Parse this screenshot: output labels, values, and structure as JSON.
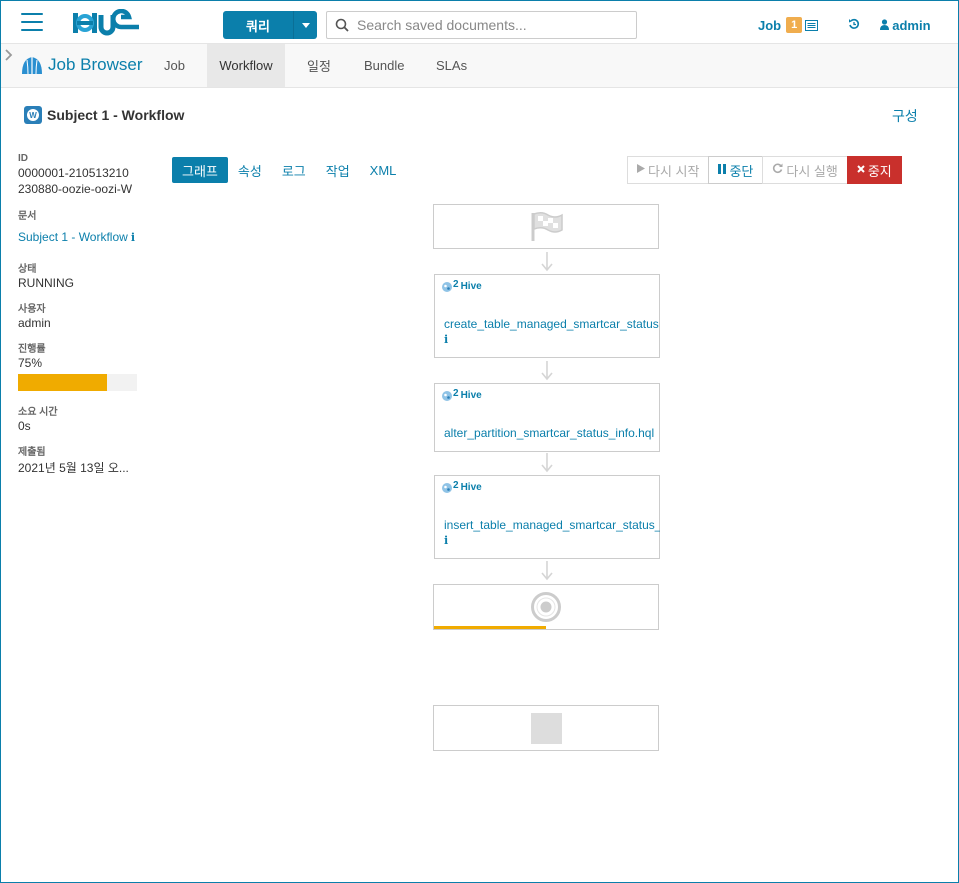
{
  "topbar": {
    "query_label": "쿼리",
    "search_placeholder": "Search saved documents...",
    "job_label": "Job",
    "job_count": "1",
    "user": "admin"
  },
  "subnav": {
    "app_title": "Job Browser",
    "tabs": [
      {
        "label": "Job"
      },
      {
        "label": "Workflow"
      },
      {
        "label": "일정"
      },
      {
        "label": "Bundle"
      },
      {
        "label": "SLAs"
      }
    ],
    "active_tab": "Workflow"
  },
  "header": {
    "icon_letter": "W",
    "title": "Subject 1 - Workflow",
    "config_label": "구성"
  },
  "sidebar": {
    "id_label": "ID",
    "id_line1": "0000001-210513210",
    "id_line2": "230880-oozie-oozi-W",
    "doc_label": "문서",
    "doc_value": "Subject 1 - Workflow",
    "status_label": "상태",
    "status_value": "RUNNING",
    "user_label": "사용자",
    "user_value": "admin",
    "progress_label": "진행률",
    "progress_value": "75%",
    "progress_fraction": 0.75,
    "duration_label": "소요 시간",
    "duration_value": "0s",
    "submitted_label": "제출됨",
    "submitted_value": "2021년 5월 13일 오..."
  },
  "tabs": [
    {
      "label": "그래프"
    },
    {
      "label": "속성"
    },
    {
      "label": "로그"
    },
    {
      "label": "작업"
    },
    {
      "label": "XML"
    }
  ],
  "actions": {
    "restart": "다시 시작",
    "suspend": "중단",
    "rerun": "다시 실행",
    "kill": "중지"
  },
  "graph": {
    "nodes": [
      {
        "type": "Hive",
        "count": "2",
        "name": "create_table_managed_smartcar_status"
      },
      {
        "type": "Hive",
        "count": "2",
        "name": "alter_partition_smartcar_status_info.hql"
      },
      {
        "type": "Hive",
        "count": "2",
        "name": "insert_table_managed_smartcar_status_"
      }
    ],
    "end_progress_fraction": 0.5
  },
  "colors": {
    "brand": "#0b7fab",
    "progress": "#f0ab00",
    "danger": "#c9302c",
    "badge": "#f0ad4e"
  }
}
